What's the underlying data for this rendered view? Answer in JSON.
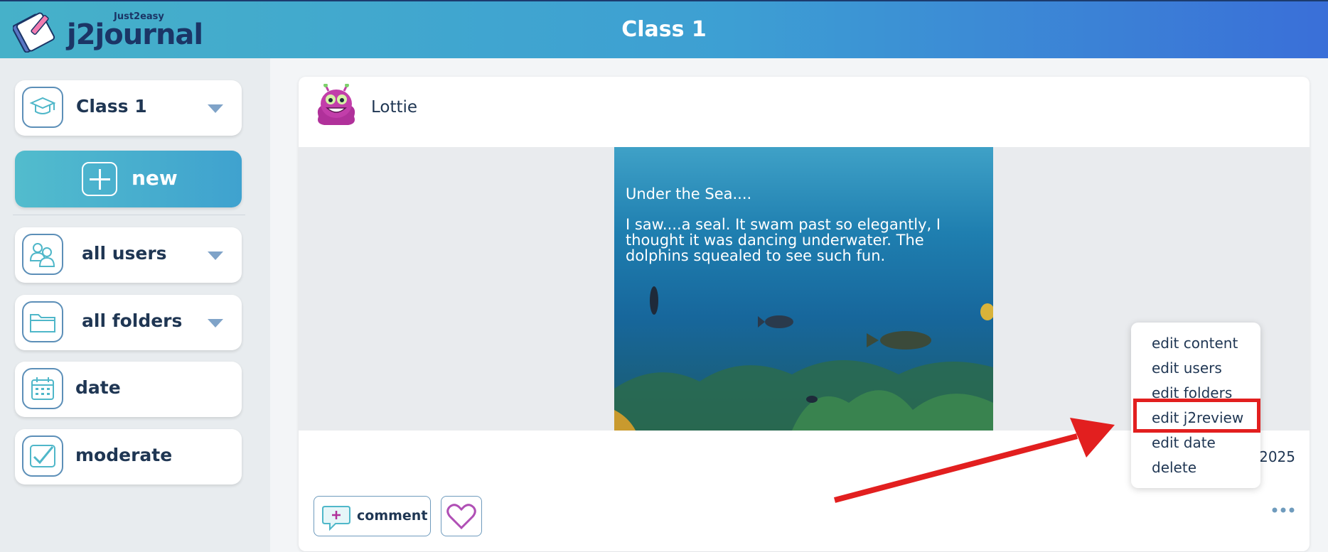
{
  "header": {
    "logo_small": "Just2easy",
    "logo_main": "j2journal",
    "title": "Class 1"
  },
  "sidebar": {
    "class_select": {
      "label": "Class 1",
      "icon": "graduation-cap-icon"
    },
    "new_button": {
      "label": "new",
      "icon": "plus-icon"
    },
    "items": [
      {
        "label": "all users",
        "icon": "users-icon",
        "dropdown": true
      },
      {
        "label": "all folders",
        "icon": "folder-icon",
        "dropdown": true
      },
      {
        "label": "date",
        "icon": "calendar-icon",
        "dropdown": false
      },
      {
        "label": "moderate",
        "icon": "checkmark-icon",
        "dropdown": false
      }
    ]
  },
  "post": {
    "author": "Lottie",
    "image_text": {
      "title": "Under the Sea....",
      "body": "I saw....a seal. It swam past so elegantly, I thought it was dancing underwater. The dolphins squealed to see such fun."
    },
    "date_fragment": "2025",
    "comment_label": "comment"
  },
  "context_menu": {
    "items": [
      "edit content",
      "edit users",
      "edit folders",
      "edit j2review",
      "edit date",
      "delete"
    ],
    "highlighted": "edit j2review"
  },
  "colors": {
    "header_start": "#46b1c9",
    "header_end": "#3a6fd8",
    "accent": "#3fa2cf",
    "highlight": "#e21f1f",
    "text": "#1f3653"
  }
}
